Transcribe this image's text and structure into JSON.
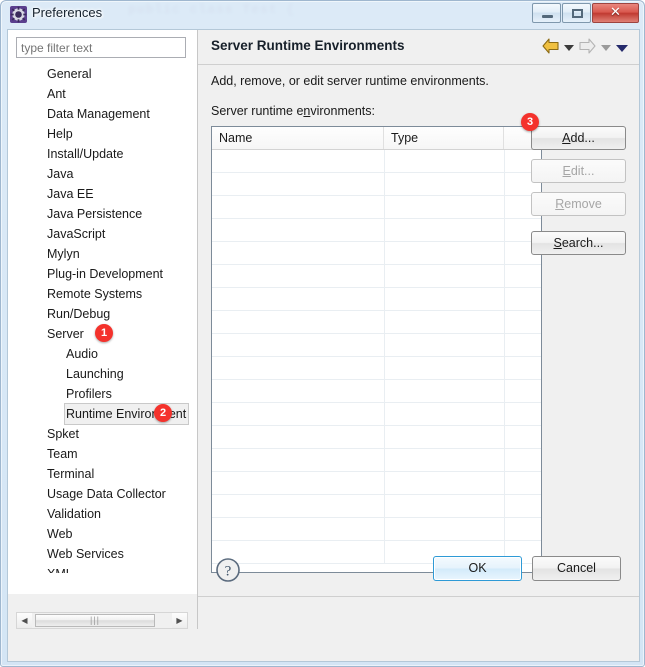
{
  "window": {
    "title": "Preferences",
    "icon": "preferences-gear-icon",
    "backdrop_code": "public class Test {",
    "controls": {
      "minimize": "minimize-button",
      "maximize": "maximize-button",
      "close_label": "✕"
    }
  },
  "sidebar": {
    "filter": {
      "placeholder": "type filter text",
      "value": ""
    },
    "items": [
      {
        "label": "General",
        "level": 0,
        "selected": false
      },
      {
        "label": "Ant",
        "level": 0,
        "selected": false
      },
      {
        "label": "Data Management",
        "level": 0,
        "selected": false
      },
      {
        "label": "Help",
        "level": 0,
        "selected": false
      },
      {
        "label": "Install/Update",
        "level": 0,
        "selected": false
      },
      {
        "label": "Java",
        "level": 0,
        "selected": false
      },
      {
        "label": "Java EE",
        "level": 0,
        "selected": false
      },
      {
        "label": "Java Persistence",
        "level": 0,
        "selected": false
      },
      {
        "label": "JavaScript",
        "level": 0,
        "selected": false
      },
      {
        "label": "Mylyn",
        "level": 0,
        "selected": false
      },
      {
        "label": "Plug-in Development",
        "level": 0,
        "selected": false
      },
      {
        "label": "Remote Systems",
        "level": 0,
        "selected": false
      },
      {
        "label": "Run/Debug",
        "level": 0,
        "selected": false
      },
      {
        "label": "Server",
        "level": 0,
        "selected": false,
        "badge": "1"
      },
      {
        "label": "Audio",
        "level": 1,
        "selected": false
      },
      {
        "label": "Launching",
        "level": 1,
        "selected": false
      },
      {
        "label": "Profilers",
        "level": 1,
        "selected": false
      },
      {
        "label": "Runtime Environment",
        "level": 1,
        "selected": true,
        "badge": "2"
      },
      {
        "label": "Spket",
        "level": 0,
        "selected": false
      },
      {
        "label": "Team",
        "level": 0,
        "selected": false
      },
      {
        "label": "Terminal",
        "level": 0,
        "selected": false
      },
      {
        "label": "Usage Data Collector",
        "level": 0,
        "selected": false
      },
      {
        "label": "Validation",
        "level": 0,
        "selected": false
      },
      {
        "label": "Web",
        "level": 0,
        "selected": false
      },
      {
        "label": "Web Services",
        "level": 0,
        "selected": false
      },
      {
        "label": "XML",
        "level": 0,
        "selected": false
      }
    ],
    "hscroll": {
      "left_arrow": "◀",
      "right_arrow": "▶",
      "thumb_grip": "|||"
    }
  },
  "content": {
    "title": "Server Runtime Environments",
    "description": "Add, remove, or edit server runtime environments.",
    "list_label_pre": "Server runtime e",
    "list_label_mnemonic": "n",
    "list_label_post": "vironments:",
    "nav": [
      {
        "name": "back-arrow-icon",
        "kind": "arrow-left",
        "state": "enabled"
      },
      {
        "name": "back-dropdown-icon",
        "kind": "triangle-dark",
        "state": "enabled"
      },
      {
        "name": "forward-arrow-icon",
        "kind": "arrow-right",
        "state": "disabled"
      },
      {
        "name": "forward-dropdown-icon",
        "kind": "triangle-gray",
        "state": "disabled"
      },
      {
        "name": "menu-dropdown-icon",
        "kind": "triangle-navy",
        "state": "enabled"
      }
    ],
    "table": {
      "columns": [
        {
          "label": "Name",
          "width": 172
        },
        {
          "label": "Type",
          "width": 120
        },
        {
          "label": "",
          "width": 37
        }
      ],
      "rows": [],
      "empty_row_count": 18
    },
    "buttons": [
      {
        "pre": "",
        "mn": "A",
        "post": "dd...",
        "enabled": true,
        "badge": "3",
        "name": "add-button"
      },
      {
        "pre": "",
        "mn": "E",
        "post": "dit...",
        "enabled": false,
        "badge": "",
        "name": "edit-button"
      },
      {
        "pre": "",
        "mn": "R",
        "post": "emove",
        "enabled": false,
        "badge": "",
        "name": "remove-button"
      },
      {
        "pre": "",
        "mn": "S",
        "post": "earch...",
        "enabled": true,
        "badge": "",
        "name": "search-button"
      }
    ]
  },
  "footer": {
    "help_icon": "help-question-icon",
    "ok_label": "OK",
    "cancel_label": "Cancel"
  },
  "colors": {
    "badge_red": "#f4322c",
    "default_button_border": "#2e9ad6",
    "title_bar": "#d6e7f6",
    "back_arrow_gold": "#e6b122"
  }
}
